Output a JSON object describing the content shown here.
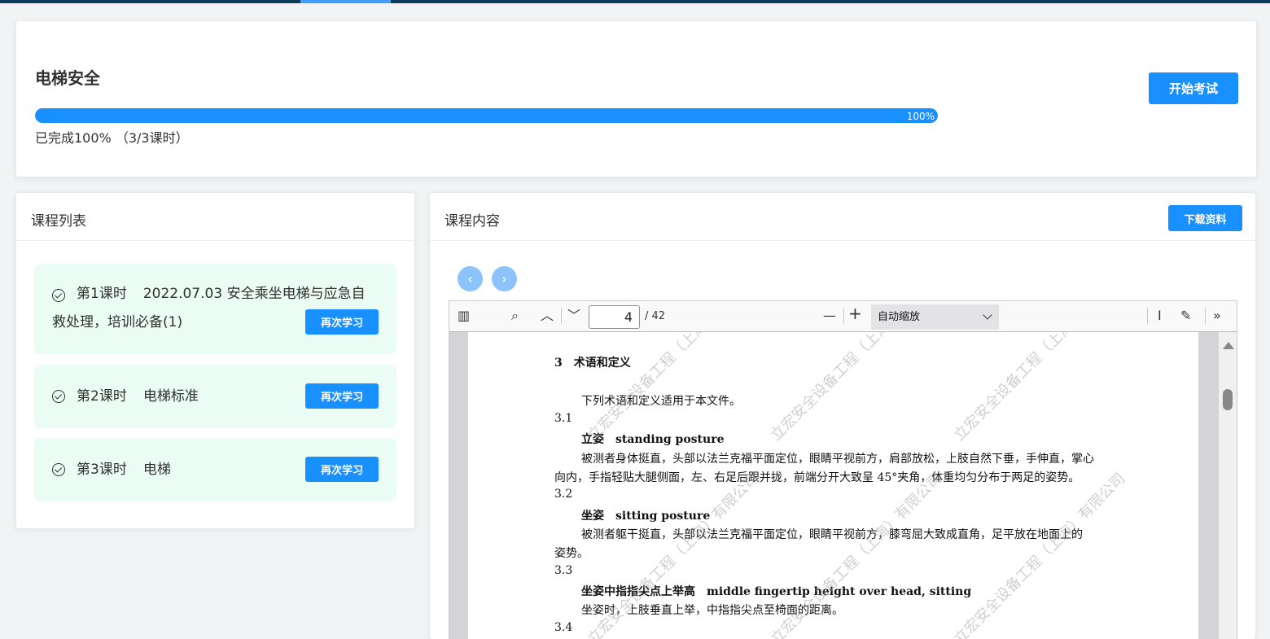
{
  "course": {
    "title": "电梯安全",
    "progress_percent": 100,
    "progress_label": "100%",
    "progress_caption": "已完成100% （3/3课时）",
    "start_exam_label": "开始考试"
  },
  "lesson_list": {
    "title": "课程列表",
    "items": [
      {
        "number": "第1课时",
        "name_line1": "2022.07.03 安全乘坐电梯与应急自",
        "name_line2": "救处理，培训必备(1)",
        "button": "再次学习"
      },
      {
        "number": "第2课时",
        "name": "电梯标准",
        "button": "再次学习"
      },
      {
        "number": "第3课时",
        "name": "电梯",
        "button": "再次学习"
      }
    ]
  },
  "content": {
    "title": "课程内容",
    "download_label": "下载资料",
    "prev_icon": "chevron-left-icon",
    "next_icon": "chevron-right-icon",
    "viewer": {
      "current_page": "4",
      "total_pages": "/ 42",
      "zoom": "自动缩放",
      "lines": [
        "3　术语和定义",
        "下列术语和定义适用于本文件。",
        "3.1",
        "立姿　standing posture",
        "被测者身体挺直，头部以法兰克福平面定位，眼睛平视前方，肩部放松，上肢自然下垂，手伸直，掌心",
        "向内，手指轻贴大腿侧面，左、右足后跟并拢，前端分开大致呈 45°夹角，体重均匀分布于两足的姿势。",
        "3.2",
        "坐姿　sitting posture",
        "被测者躯干挺直，头部以法兰克福平面定位，眼睛平视前方，膝弯屈大致成直角，足平放在地面上的",
        "姿势。",
        "3.3",
        "坐姿中指指尖点上举高　middle fingertip height over head, sitting",
        "坐姿时，上肢垂直上举，中指指尖点至椅面的距离。",
        "3.4"
      ],
      "watermark": "立宏安全设备工程（上海）有限公司"
    }
  }
}
